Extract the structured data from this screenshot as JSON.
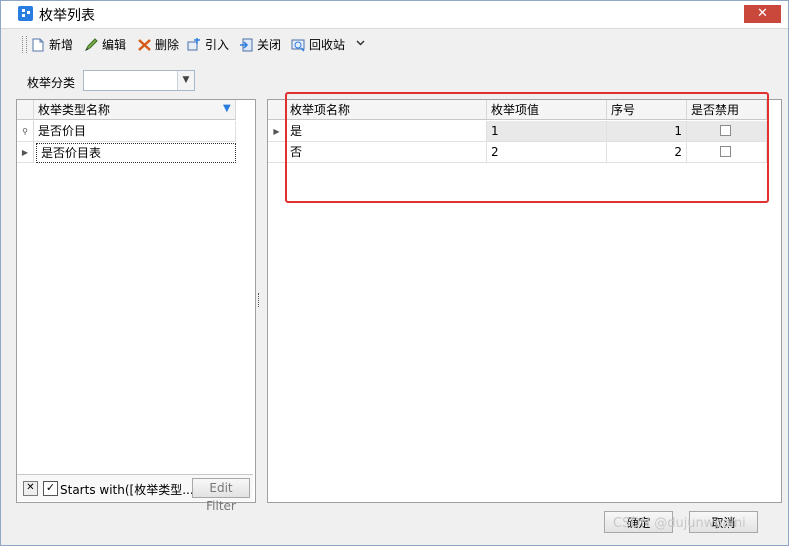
{
  "window": {
    "title": "枚举列表",
    "close_label": "✕"
  },
  "toolbar": {
    "new_label": "新增",
    "edit_label": "编辑",
    "delete_label": "删除",
    "import_label": "引入",
    "close_label": "关闭",
    "recycle_label": "回收站",
    "more_icon": "chevron-down-icon"
  },
  "category_filter": {
    "label": "枚举分类",
    "value": ""
  },
  "type_list": {
    "header": "枚举类型名称",
    "rows": [
      "是否价目",
      "是否价目表"
    ],
    "filter_text": "Starts with([枚举类型...",
    "edit_filter_label": "Edit Filter"
  },
  "items_grid": {
    "columns": [
      "枚举项名称",
      "枚举项值",
      "序号",
      "是否禁用"
    ],
    "rows": [
      {
        "name": "是",
        "value": "1",
        "order": "1",
        "disabled": false
      },
      {
        "name": "否",
        "value": "2",
        "order": "2",
        "disabled": false
      }
    ]
  },
  "footer": {
    "ok_label": "确定",
    "cancel_label": "取消"
  },
  "watermark": "CSDN @dujunwoaini",
  "colors": {
    "accent": "#2a7de0",
    "close": "#c9483b",
    "highlight_box": "#e03030"
  }
}
